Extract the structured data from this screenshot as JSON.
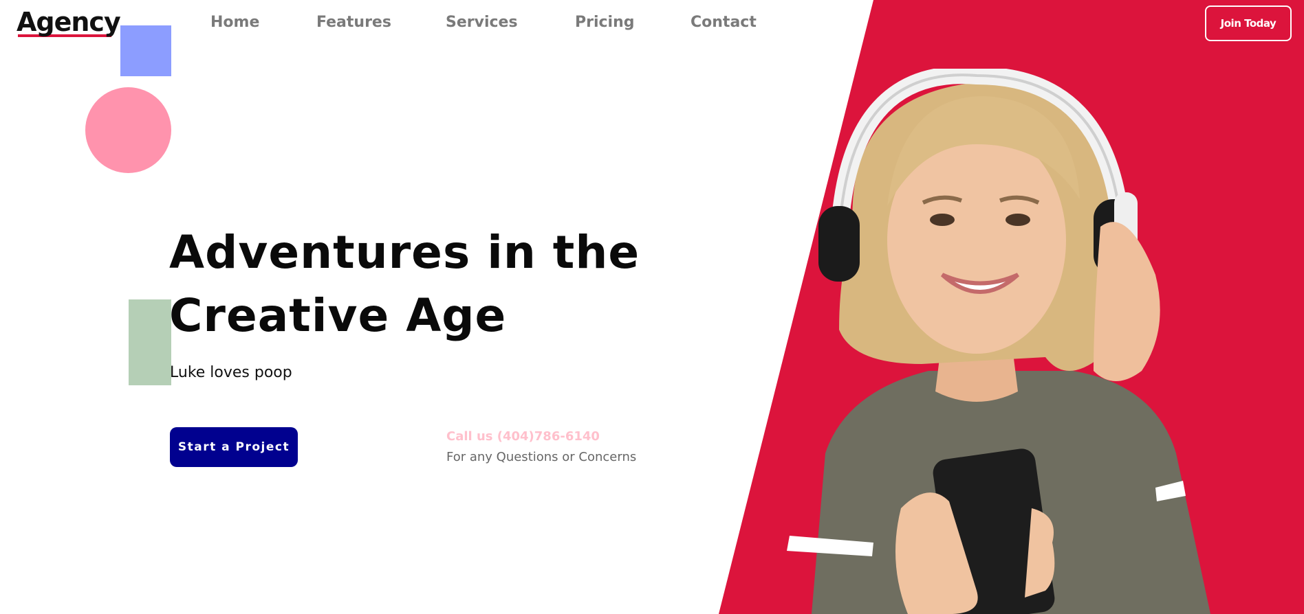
{
  "brand": {
    "logo_text": "Agency",
    "accent_color": "#dc143c"
  },
  "nav": {
    "items": [
      {
        "label": "Home"
      },
      {
        "label": "Features"
      },
      {
        "label": "Services"
      },
      {
        "label": "Pricing"
      },
      {
        "label": "Contact"
      }
    ],
    "join_label": "Join Today"
  },
  "hero": {
    "title_line1": "Adventures in the",
    "title_line2": "Creative Age",
    "subtitle": "Luke loves poop",
    "cta_label": "Start a Project",
    "cta_color": "#01018f",
    "call_text": "Call us (404)786-6140",
    "call_subtext": "For any Questions or Concerns",
    "image_icon": "woman-with-headphones-photo"
  },
  "decor": {
    "square_color": "#8c9dff",
    "circle_color": "#ff93ad",
    "rect_color": "#b5cfb6"
  }
}
